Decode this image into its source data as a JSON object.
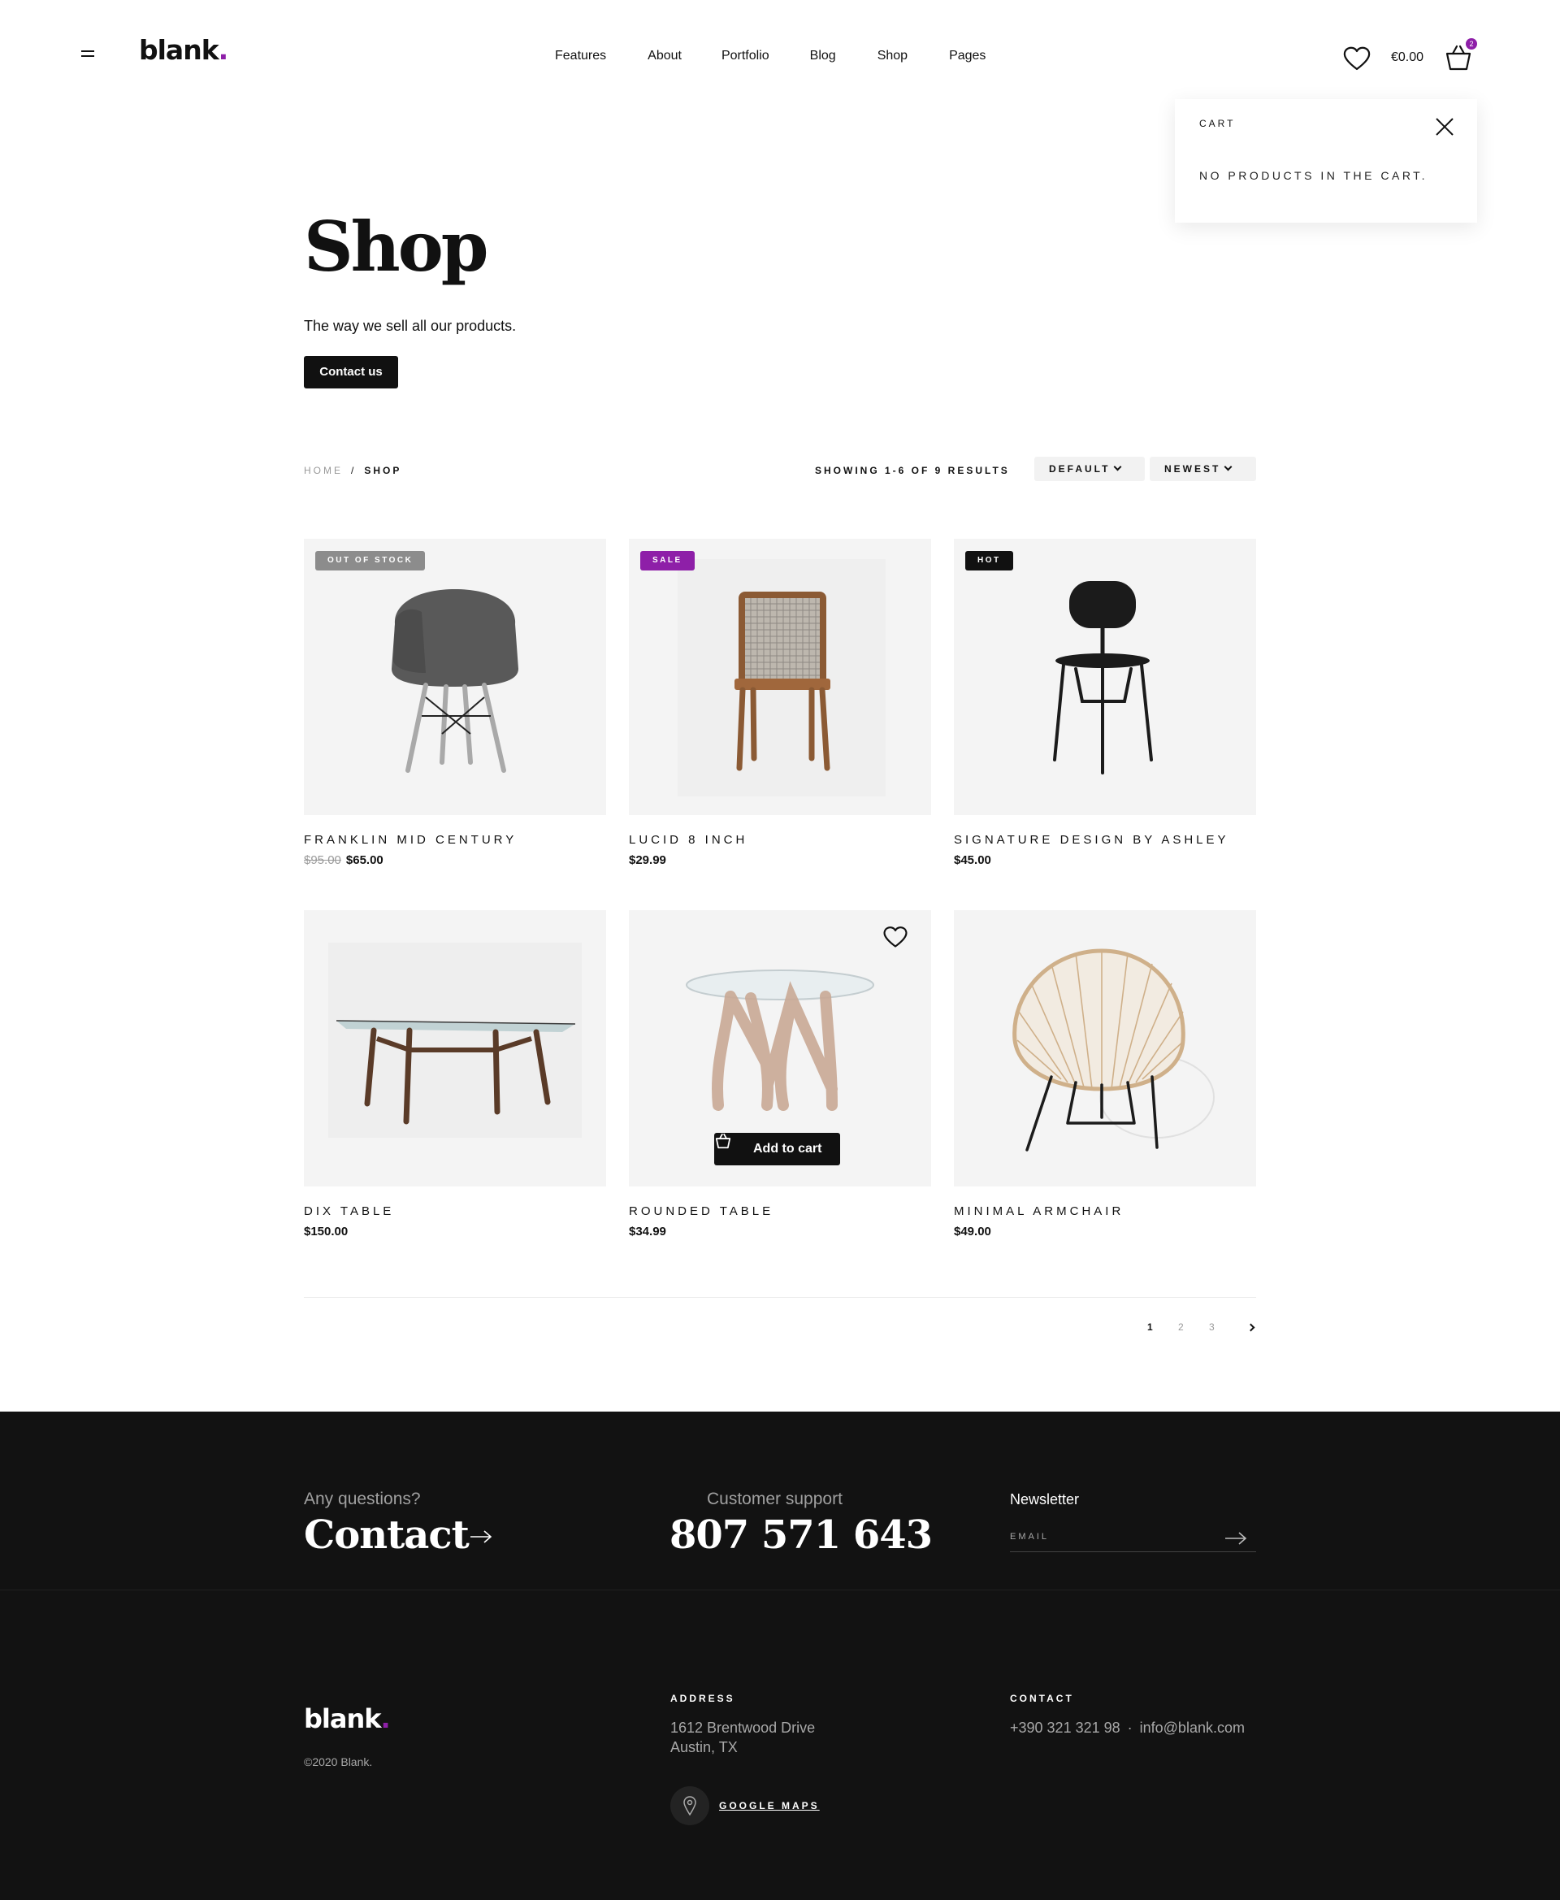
{
  "header": {
    "logo": "blank",
    "logo_dot": ".",
    "nav": [
      "Features",
      "About",
      "Portfolio",
      "Blog",
      "Shop",
      "Pages"
    ],
    "cart_total": "€0.00",
    "cart_count": "2"
  },
  "cart_panel": {
    "title": "CART",
    "empty_message": "NO PRODUCTS IN THE CART."
  },
  "hero": {
    "title": "Shop",
    "subtitle": "The way we sell all our products.",
    "cta": "Contact us"
  },
  "toolbar": {
    "breadcrumb_home": "HOME",
    "breadcrumb_sep": "/",
    "breadcrumb_current": "SHOP",
    "results": "SHOWING 1-6 OF 9 RESULTS",
    "sort_default": "DEFAULT",
    "sort_order": "NEWEST"
  },
  "products": [
    {
      "name": "FRANKLIN MID CENTURY",
      "old_price": "$95.00",
      "price": "$65.00",
      "badge": "OUT OF STOCK",
      "badge_color": "#8c8c8c"
    },
    {
      "name": "LUCID 8 INCH",
      "price": "$29.99",
      "badge": "SALE",
      "badge_color": "#8e1fa8"
    },
    {
      "name": "SIGNATURE DESIGN BY ASHLEY",
      "price": "$45.00",
      "badge": "HOT",
      "badge_color": "#111111"
    },
    {
      "name": "DIX TABLE",
      "price": "$150.00"
    },
    {
      "name": "ROUNDED TABLE",
      "price": "$34.99",
      "add_to_cart": "Add to cart"
    },
    {
      "name": "MINIMAL ARMCHAIR",
      "price": "$49.00"
    }
  ],
  "pagination": {
    "pages": [
      "1",
      "2",
      "3"
    ],
    "current": "1"
  },
  "footer": {
    "questions": "Any questions?",
    "contact": "Contact",
    "support_label": "Customer support",
    "phone": "807 571 643",
    "newsletter": "Newsletter",
    "email_placeholder": "EMAIL",
    "logo": "blank",
    "logo_dot": ".",
    "copyright": "©2020 Blank.",
    "address_title": "ADDRESS",
    "address_line1": "1612  Brentwood Drive",
    "address_line2": "Austin, TX",
    "map_link": "GOOGLE MAPS",
    "contact_title": "CONTACT",
    "contact_phone": "+390 321 321 98",
    "contact_sep": "·",
    "contact_email": "info@blank.com"
  },
  "colors": {
    "accent": "#8e1fa8",
    "dark": "#111111",
    "footer_bg": "#121212",
    "product_bg": "#f4f4f4"
  }
}
